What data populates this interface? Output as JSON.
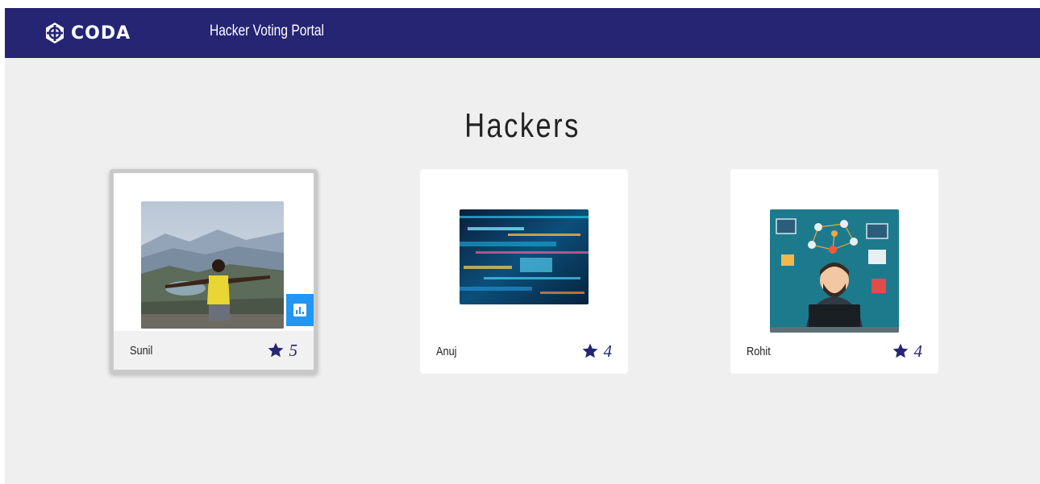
{
  "navbar": {
    "brand": "CODA",
    "title": "Hacker Voting Portal",
    "bg_color": "#252574"
  },
  "page": {
    "title": "Hackers"
  },
  "hackers": [
    {
      "name": "Sunil",
      "rating": "5",
      "image": "photo-mountain-man",
      "selected": true
    },
    {
      "name": "Anuj",
      "rating": "4",
      "image": "code-abstract",
      "selected": false
    },
    {
      "name": "Rohit",
      "rating": "4",
      "image": "hacker-illustration",
      "selected": false
    }
  ],
  "colors": {
    "accent": "#252574",
    "stats_button": "#2196f3",
    "background": "#efefef"
  },
  "icons": {
    "brand": "crosshair-logo-icon",
    "rating": "star-icon",
    "stats": "bar-chart-icon"
  }
}
